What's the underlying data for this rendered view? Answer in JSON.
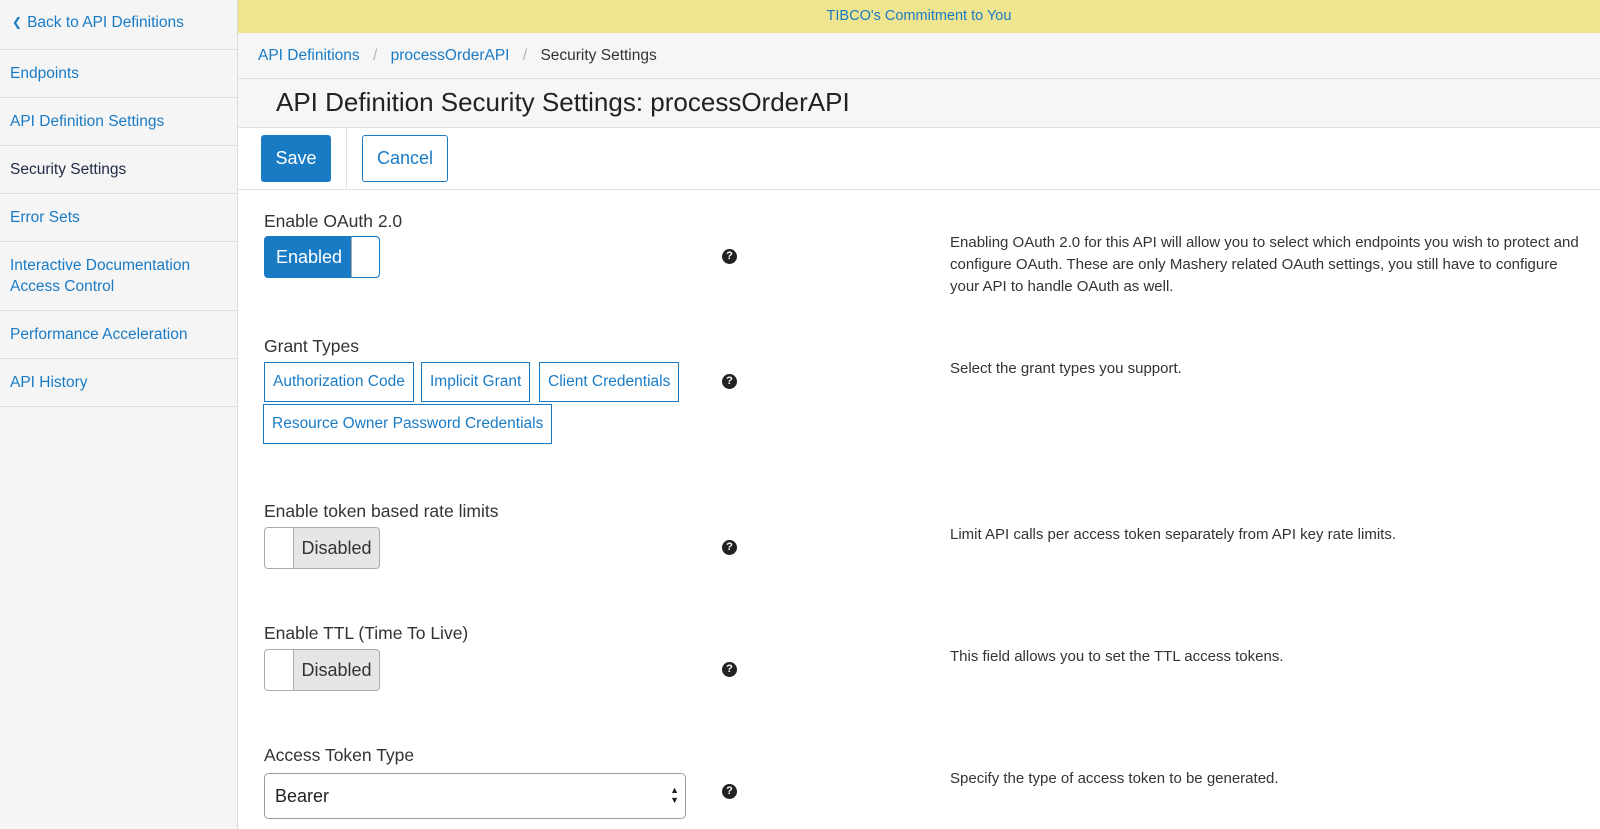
{
  "sidebar": {
    "back_label": "Back to API Definitions",
    "items": [
      {
        "label": "Endpoints"
      },
      {
        "label": "API Definition Settings"
      },
      {
        "label": "Security Settings"
      },
      {
        "label": "Error Sets"
      },
      {
        "label": "Interactive Documentation Access Control"
      },
      {
        "label": "Performance Acceleration"
      },
      {
        "label": "API History"
      }
    ]
  },
  "banner": {
    "text": "TIBCO's Commitment to You"
  },
  "breadcrumb": {
    "items": [
      "API Definitions",
      "processOrderAPI",
      "Security Settings"
    ],
    "separator": "/"
  },
  "page": {
    "title": "API Definition Security Settings: processOrderAPI"
  },
  "toolbar": {
    "save_label": "Save",
    "cancel_label": "Cancel"
  },
  "fields": {
    "oauth": {
      "label": "Enable OAuth 2.0",
      "toggle": "Enabled",
      "description": "Enabling OAuth 2.0 for this API will allow you to select which endpoints you wish to protect and configure OAuth. These are only Mashery related OAuth settings, you still have to configure your API to handle OAuth as well."
    },
    "grant_types": {
      "label": "Grant Types",
      "options": [
        "Authorization Code",
        "Implicit Grant",
        "Client Credentials",
        "Resource Owner Password Credentials"
      ],
      "description": "Select the grant types you support."
    },
    "token_rate_limits": {
      "label": "Enable token based rate limits",
      "toggle": "Disabled",
      "description": "Limit API calls per access token separately from API key rate limits."
    },
    "ttl": {
      "label": "Enable TTL (Time To Live)",
      "toggle": "Disabled",
      "description": "This field allows you to set the TTL access tokens."
    },
    "access_token_type": {
      "label": "Access Token Type",
      "selected": "Bearer",
      "description": "Specify the type of access token to be generated."
    }
  },
  "help_icon": "question-circle-icon",
  "colors": {
    "accent": "#1a7bc5",
    "banner": "#efe58f",
    "sidebar_bg": "#f5f5f5"
  }
}
